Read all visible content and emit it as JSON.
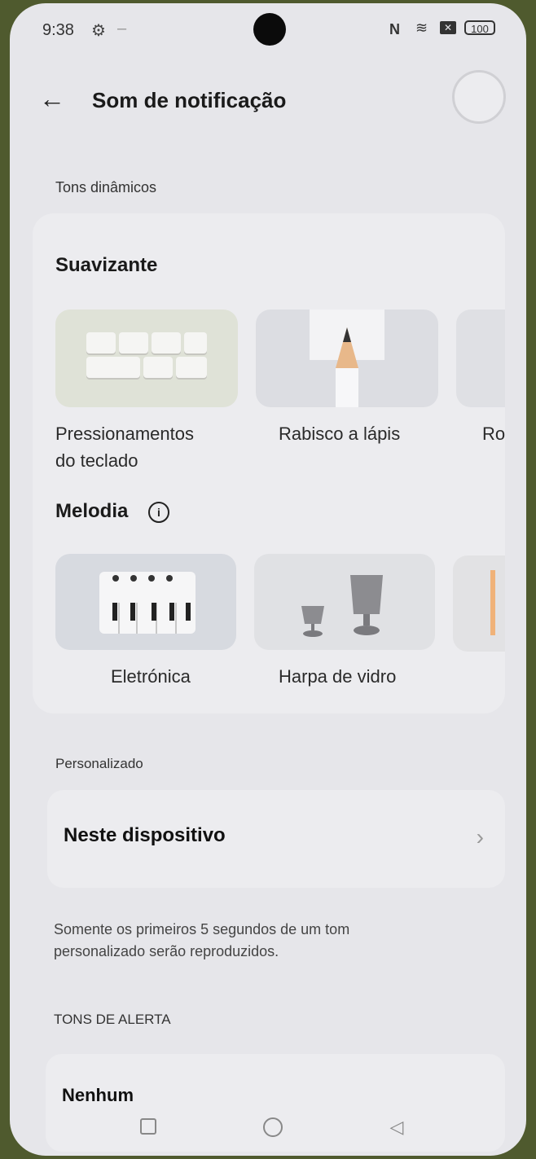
{
  "status_bar": {
    "time": "9:38",
    "battery": "100"
  },
  "header": {
    "title": "Som de notificação"
  },
  "dynamic": {
    "section_label": "Tons dinâmicos",
    "smooth_heading": "Suavizante",
    "smooth_items": [
      {
        "label_line1": "Pressionamentos",
        "label_line2": "do teclado"
      },
      {
        "label_line1": "Rabisco a lápis",
        "label_line2": ""
      },
      {
        "label_line1": "Ro",
        "label_line2": ""
      }
    ],
    "melody_heading": "Melodia",
    "melody_items": [
      {
        "label": "Eletrónica"
      },
      {
        "label": "Harpa de vidro"
      }
    ]
  },
  "custom": {
    "section_label": "Personalizado",
    "item_label": "Neste dispositivo",
    "note_line1": "Somente os primeiros 5 segundos de um tom",
    "note_line2": "personalizado serão reproduzidos."
  },
  "alert": {
    "section_label": "TONS DE ALERTA",
    "first_item": "Nenhum"
  },
  "icons": {
    "back": "arrow-left-icon",
    "info": "info-icon",
    "chevron": "chevron-right-icon",
    "settings": "gear-icon",
    "nfc": "nfc-icon",
    "wifi": "wifi-icon"
  }
}
